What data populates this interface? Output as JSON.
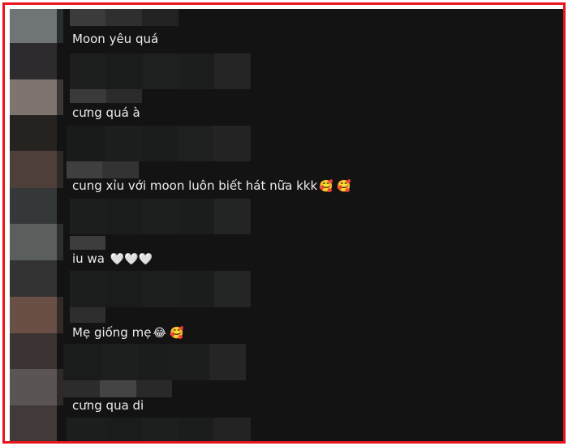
{
  "colors": {
    "frame_border": "#e8141c",
    "panel_bg": "#131313",
    "text": "#ececec"
  },
  "comments": [
    {
      "text": "Moon yêu quá"
    },
    {
      "text": "cưng quá à"
    },
    {
      "text": "cung xỉu với moon luôn biết hát nữa kkk",
      "emoji": "🥰 🥰"
    },
    {
      "text": "iu wa",
      "emoji": "🤍🤍🤍"
    },
    {
      "text": "Mẹ giống mẹ",
      "emoji": "😂 🥰"
    },
    {
      "text": "cưng qua di"
    }
  ]
}
